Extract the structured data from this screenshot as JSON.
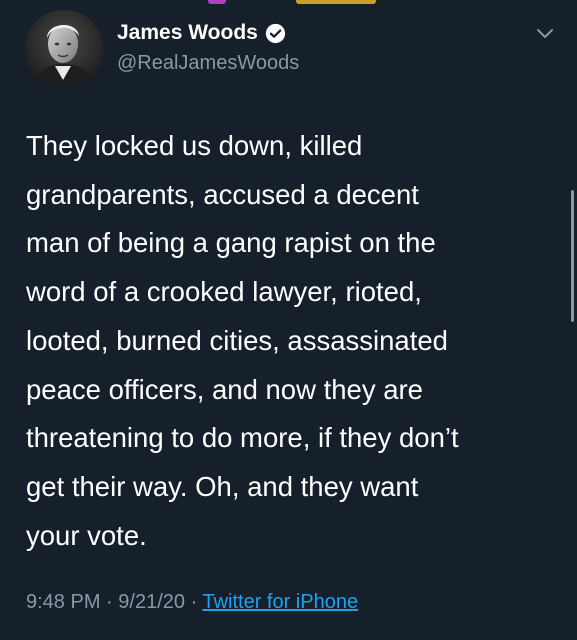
{
  "tweet": {
    "author_name": "James Woods",
    "author_handle": "@RealJamesWoods",
    "verified": true,
    "text": "They locked us down, killed\ngrandparents, accused a decent\nman of being a gang rapist on the\nword of a crooked lawyer, rioted,\nlooted, burned cities, assassinated\npeace officers, and now they are\nthreatening to do more, if they don’t\nget their way. Oh, and they want\nyour vote.",
    "time": "9:48 PM",
    "separator": "·",
    "date": "9/21/20",
    "source": "Twitter for iPhone"
  },
  "icons": {
    "verified": "verified-badge-icon",
    "menu": "chevron-down-icon"
  },
  "colors": {
    "background": "#15202b",
    "text": "#ffffff",
    "secondary_text": "#8899a6",
    "link": "#1da1f2"
  }
}
